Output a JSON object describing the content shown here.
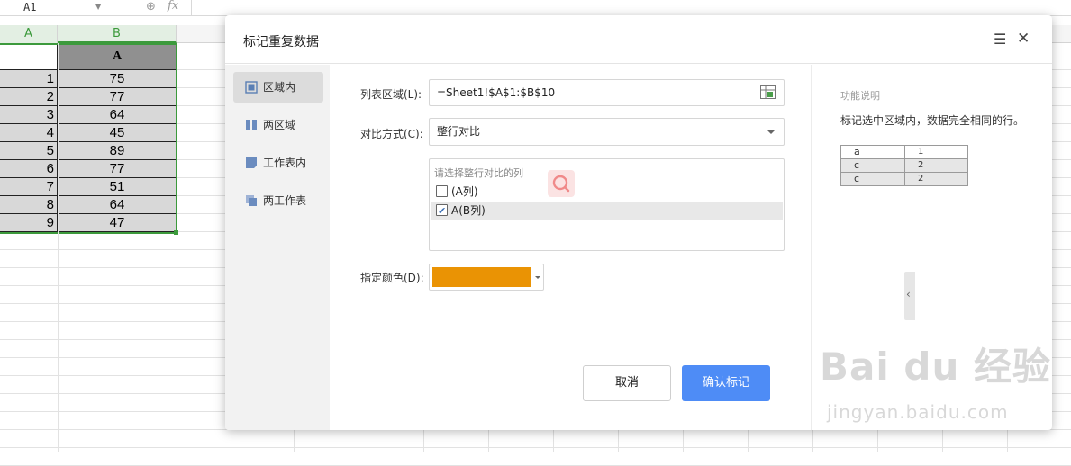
{
  "formula_bar": {
    "cell_ref": "A1"
  },
  "columns": [
    "A",
    "B"
  ],
  "sheet_rows": [
    {
      "a": "",
      "b": "A"
    },
    {
      "a": "1",
      "b": "75"
    },
    {
      "a": "2",
      "b": "77"
    },
    {
      "a": "3",
      "b": "64"
    },
    {
      "a": "4",
      "b": "45"
    },
    {
      "a": "5",
      "b": "89"
    },
    {
      "a": "6",
      "b": "77"
    },
    {
      "a": "7",
      "b": "51"
    },
    {
      "a": "8",
      "b": "64"
    },
    {
      "a": "9",
      "b": "47"
    }
  ],
  "dialog": {
    "title": "标记重复数据",
    "sidebar": [
      {
        "label": "区域内",
        "active": true
      },
      {
        "label": "两区域",
        "active": false
      },
      {
        "label": "工作表内",
        "active": false
      },
      {
        "label": "两工作表",
        "active": false
      }
    ],
    "range_label": "列表区域(L):",
    "range_value": "=Sheet1!$A$1:$B$10",
    "mode_label": "对比方式(C):",
    "mode_value": "整行对比",
    "columns_prompt": "请选择整行对比的列",
    "column_options": [
      {
        "label": "(A列)",
        "checked": false
      },
      {
        "label": "A(B列)",
        "checked": true
      }
    ],
    "color_label": "指定颜色(D):",
    "color_value": "#ea9304",
    "cancel_label": "取消",
    "confirm_label": "确认标记",
    "help": {
      "title": "功能说明",
      "text": "标记选中区域内，数据完全相同的行。",
      "example_rows": [
        {
          "c1": "a",
          "c2": "1"
        },
        {
          "c1": "c",
          "c2": "2"
        },
        {
          "c1": "c",
          "c2": "2"
        }
      ]
    }
  },
  "watermark": {
    "logo": "Bai du 经验",
    "url": "jingyan.baidu.com"
  },
  "colors": {
    "accent_green": "#3c9a3c",
    "confirm_blue": "#4e8cf6",
    "arrow_red": "#e53935"
  }
}
